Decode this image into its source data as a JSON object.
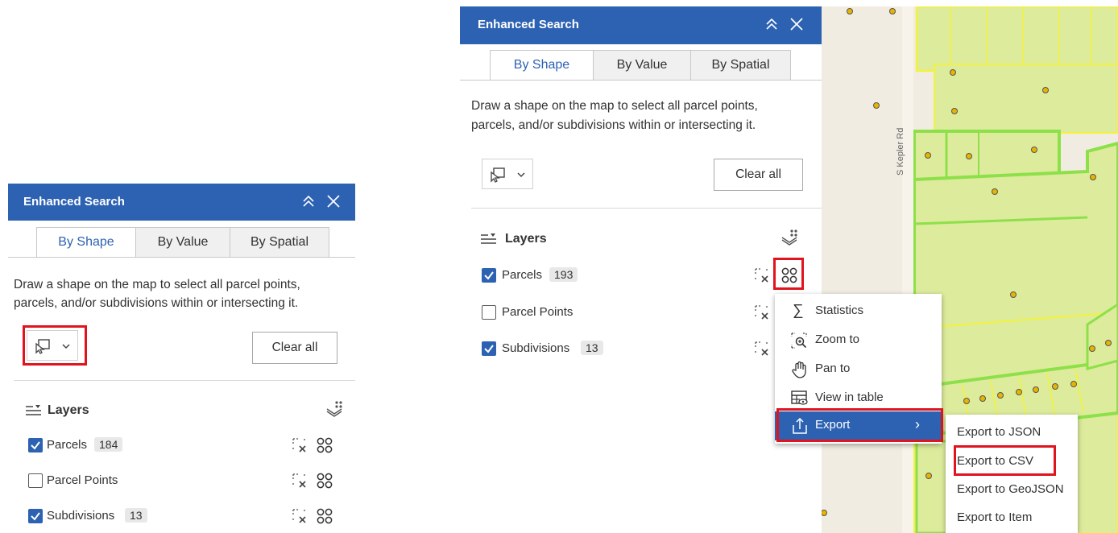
{
  "left_panel": {
    "title": "Enhanced Search",
    "tabs": [
      "By Shape",
      "By Value",
      "By Spatial"
    ],
    "description_line1": "Draw a shape on the map to select all parcel points,",
    "description_line2": "parcels, and/or subdivisions within or intersecting it.",
    "clear_all": "Clear all",
    "layers_title": "Layers",
    "layers": [
      {
        "name": "Parcels",
        "count": "184",
        "checked": true
      },
      {
        "name": "Parcel Points",
        "count": "",
        "checked": false
      },
      {
        "name": "Subdivisions",
        "count": "13",
        "checked": true
      }
    ]
  },
  "right_panel": {
    "title": "Enhanced Search",
    "tabs": [
      "By Shape",
      "By Value",
      "By Spatial"
    ],
    "description_line1": "Draw a shape on the map to select all parcel points,",
    "description_line2": "parcels, and/or subdivisions within or intersecting it.",
    "clear_all": "Clear all",
    "layers_title": "Layers",
    "layers": [
      {
        "name": "Parcels",
        "count": "193",
        "checked": true
      },
      {
        "name": "Parcel Points",
        "count": "",
        "checked": false
      },
      {
        "name": "Subdivisions",
        "count": "13",
        "checked": true
      }
    ]
  },
  "context_menu": {
    "items": [
      "Statistics",
      "Zoom to",
      "Pan to",
      "View in table",
      "Export"
    ],
    "highlighted": "Export",
    "submenu_arrow": "›"
  },
  "export_submenu": {
    "items": [
      "Export to JSON",
      "Export to CSV",
      "Export to GeoJSON",
      "Export to Item"
    ]
  },
  "map": {
    "street_label": "S Kepler Rd"
  },
  "colors": {
    "header_blue": "#2d62b3",
    "highlight_red": "#e0141e",
    "parcel_fill": "#dceb9c",
    "parcel_outline": "#f4f23c",
    "selected_outline": "#8ee04a",
    "point_fill": "#e8b400"
  }
}
